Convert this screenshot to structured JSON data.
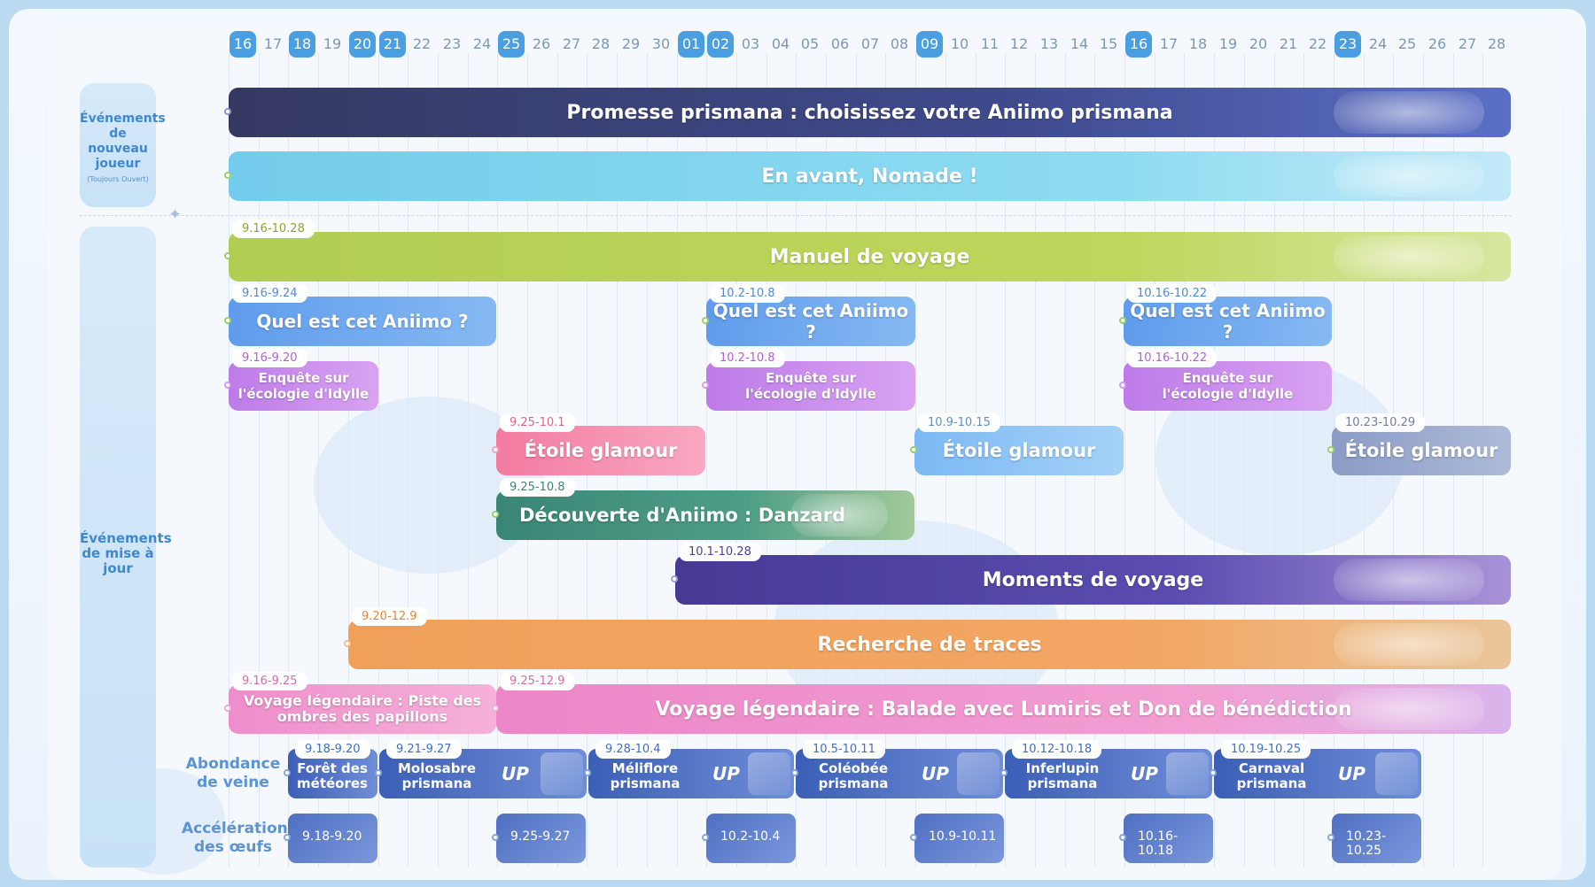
{
  "colors": {
    "highlight_date": "#4a9fe3",
    "new_player_bar": "#3d4080",
    "nomade_bar": "#7fd4ec",
    "manuel_bar": "#b4cf55",
    "quiz_bar": "#6fa6ee",
    "enquete_bar": "#c585ea",
    "etoile_pink": "#f57fa3",
    "etoile_blue": "#86c1f5",
    "etoile_grey": "#8f9fc4",
    "danzard_bar": "#3f8d7c",
    "moments_bar": "#4a3f96",
    "traces_bar": "#f1a35b",
    "legendaire_bar": "#ef8fcd",
    "up_bar": "#4f6fc2"
  },
  "dates": [
    "16",
    "17",
    "18",
    "19",
    "20",
    "21",
    "22",
    "23",
    "24",
    "25",
    "26",
    "27",
    "28",
    "29",
    "30",
    "01",
    "02",
    "03",
    "04",
    "05",
    "06",
    "07",
    "08",
    "09",
    "10",
    "11",
    "12",
    "13",
    "14",
    "15",
    "16",
    "17",
    "18",
    "19",
    "20",
    "21",
    "22",
    "23",
    "24",
    "25",
    "26",
    "27",
    "28"
  ],
  "highlighted_dates": [
    0,
    2,
    4,
    5,
    9,
    15,
    16,
    23,
    30,
    37
  ],
  "categories": {
    "new_player": {
      "label": "Événements de nouveau joueur",
      "note": "(Toujours Ouvert)"
    },
    "update": {
      "label": "Événements de mise à jour"
    }
  },
  "row_labels": {
    "abondance": "Abondance de veine",
    "acceleration": "Accélération des œufs"
  },
  "events": {
    "promesse": {
      "title": "Promesse prismana : choisissez votre Aniimo prismana"
    },
    "nomade": {
      "title": "En avant, Nomade !"
    },
    "manuel": {
      "title": "Manuel de voyage",
      "dates": "9.16-10.28"
    },
    "quiz1": {
      "title": "Quel est cet Aniimo ?",
      "dates": "9.16-9.24"
    },
    "quiz2": {
      "title": "Quel est cet Aniimo ?",
      "dates": "10.2-10.8"
    },
    "quiz3": {
      "title": "Quel est cet Aniimo ?",
      "dates": "10.16-10.22"
    },
    "enquete1": {
      "title": "Enquête sur l'écologie d'Idylle",
      "dates": "9.16-9.20"
    },
    "enquete2": {
      "title": "Enquête sur l'écologie d'Idylle",
      "dates": "10.2-10.8"
    },
    "enquete3": {
      "title": "Enquête sur l'écologie d'Idylle",
      "dates": "10.16-10.22"
    },
    "etoile1": {
      "title": "Étoile glamour",
      "dates": "9.25-10.1"
    },
    "etoile2": {
      "title": "Étoile glamour",
      "dates": "10.9-10.15"
    },
    "etoile3": {
      "title": "Étoile glamour",
      "dates": "10.23-10.29"
    },
    "danzard": {
      "title": "Découverte d'Aniimo : Danzard",
      "dates": "9.25-10.8"
    },
    "moments": {
      "title": "Moments de voyage",
      "dates": "10.1-10.28"
    },
    "traces": {
      "title": "Recherche de traces",
      "dates": "9.20-12.9"
    },
    "legend1": {
      "title": "Voyage légendaire : Piste des ombres des papillons",
      "dates": "9.16-9.25"
    },
    "legend2": {
      "title": "Voyage légendaire : Balade avec Lumiris et Don de bénédiction",
      "dates": "9.25-12.9"
    }
  },
  "up_events": [
    {
      "name": "Forêt des météores",
      "dates": "9.18-9.20",
      "tag": ""
    },
    {
      "name": "Molosabre prismana",
      "dates": "9.21-9.27",
      "tag": "UP"
    },
    {
      "name": "Méliflore prismana",
      "dates": "9.28-10.4",
      "tag": "UP"
    },
    {
      "name": "Coléobée prismana",
      "dates": "10.5-10.11",
      "tag": "UP"
    },
    {
      "name": "Inferlupin prismana",
      "dates": "10.12-10.18",
      "tag": "UP"
    },
    {
      "name": "Carnaval prismana",
      "dates": "10.19-10.25",
      "tag": "UP"
    }
  ],
  "egg_events": [
    "9.18-9.20",
    "9.25-9.27",
    "10.2-10.4",
    "10.9-10.11",
    "10.16-10.18",
    "10.23-10.25"
  ]
}
